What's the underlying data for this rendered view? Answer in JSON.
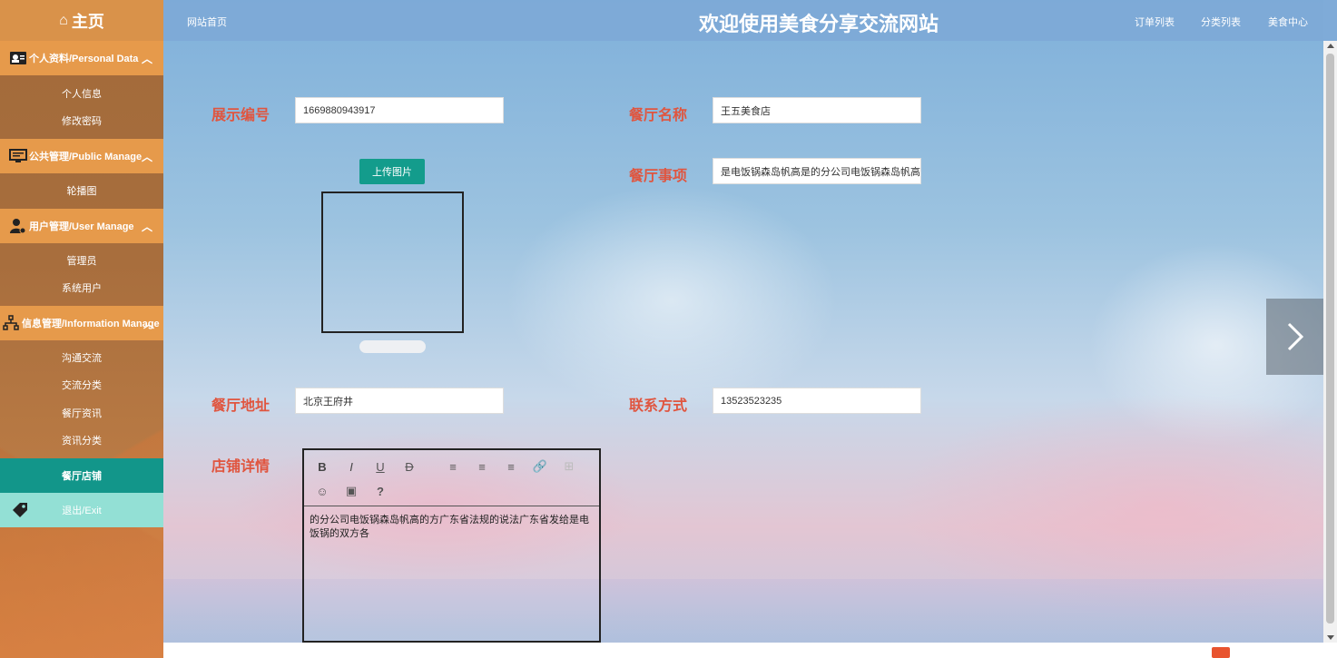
{
  "sidebar": {
    "home": "主页",
    "groups": [
      {
        "label": "个人资料/Personal Data",
        "items": [
          "个人信息",
          "修改密码"
        ]
      },
      {
        "label": "公共管理/Public Manage",
        "items": [
          "轮播图"
        ]
      },
      {
        "label": "用户管理/User Manage",
        "items": [
          "管理员",
          "系统用户"
        ]
      },
      {
        "label": "信息管理/Information Manage",
        "items": [
          "沟通交流",
          "交流分类",
          "餐厅资讯",
          "资讯分类"
        ]
      }
    ],
    "active_item": "餐厅店铺",
    "exit": "退出/Exit"
  },
  "header": {
    "home_link": "网站首页",
    "title": "欢迎使用美食分享交流网站",
    "nav": [
      "订单列表",
      "分类列表",
      "美食中心"
    ]
  },
  "form": {
    "display_id": {
      "label": "展示编号",
      "value": "1669880943917"
    },
    "restaurant_name": {
      "label": "餐厅名称",
      "value": "王五美食店"
    },
    "upload_button": "上传图片",
    "restaurant_items": {
      "label": "餐厅事项",
      "value": "是电饭锅森岛帆高是的分公司电饭锅森岛帆高"
    },
    "address": {
      "label": "餐厅地址",
      "value": "北京王府井"
    },
    "contact": {
      "label": "联系方式",
      "value": "13523523235"
    },
    "details": {
      "label": "店铺详情",
      "text": "的分公司电饭锅森岛帆高的方广东省法规的说法广东省发给是电饭锅的双方各"
    }
  },
  "colors": {
    "sidebar_group": "#e69a4b",
    "active_item": "#12968a",
    "exit_bg": "#93e0d5",
    "label_red": "#e0553f",
    "upload_green": "#139c8c"
  }
}
